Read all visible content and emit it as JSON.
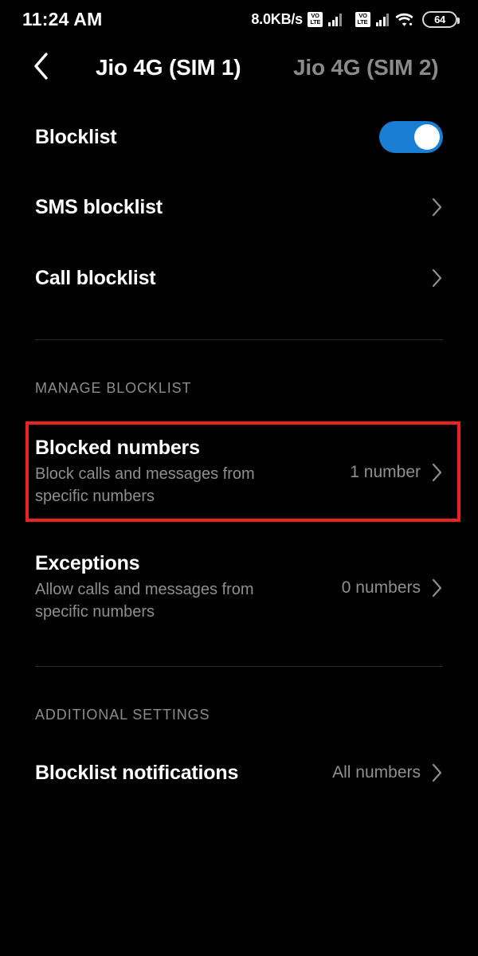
{
  "statusbar": {
    "clock": "11:24 AM",
    "net_speed": "8.0KB/s",
    "volte_top": "VO",
    "volte_bottom": "LTE",
    "battery_level": "64",
    "icons": [
      "volte-icon",
      "signal-bars-icon",
      "volte-icon",
      "signal-bars-icon",
      "wifi-icon",
      "battery-icon"
    ]
  },
  "header": {
    "back_icon": "back-chevron-icon",
    "tabs": [
      {
        "label": "Jio 4G (SIM 1)",
        "active": true
      },
      {
        "label": "Jio 4G (SIM 2)",
        "active": false
      }
    ]
  },
  "main": {
    "blocklist_toggle": {
      "label": "Blocklist",
      "state": "on",
      "accent_color": "#1a7fd4"
    },
    "links": [
      {
        "title": "SMS blocklist",
        "chevron": "chevron-right-icon"
      },
      {
        "title": "Call blocklist",
        "chevron": "chevron-right-icon"
      }
    ],
    "manage_section": {
      "header": "MANAGE BLOCKLIST",
      "items": [
        {
          "title": "Blocked numbers",
          "subtitle": "Block calls and messages from specific numbers",
          "value": "1 number",
          "highlighted": true
        },
        {
          "title": "Exceptions",
          "subtitle": "Allow calls and messages from specific numbers",
          "value": "0 numbers",
          "highlighted": false
        }
      ]
    },
    "additional_section": {
      "header": "ADDITIONAL SETTINGS",
      "items": [
        {
          "title": "Blocklist notifications",
          "value": "All numbers"
        }
      ]
    }
  },
  "highlight": {
    "color": "#ee2020",
    "target": "Blocked numbers"
  }
}
